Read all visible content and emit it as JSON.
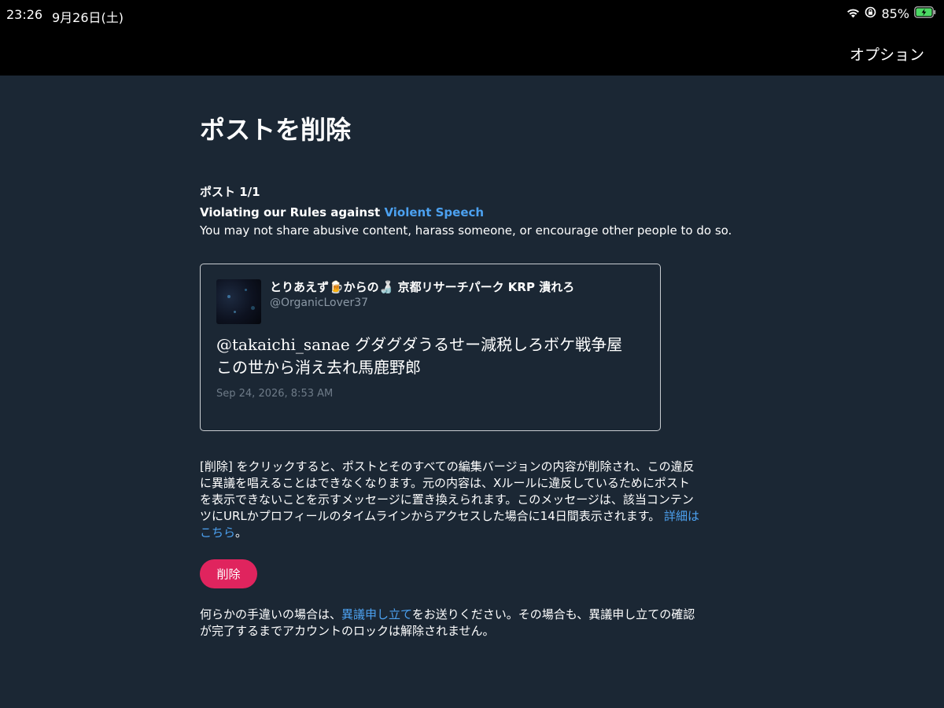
{
  "status_bar": {
    "time": "23:26",
    "date": "9月26日(土)",
    "battery": "85%"
  },
  "nav": {
    "options_label": "オプション"
  },
  "page": {
    "title": "ポストを削除",
    "post_count": "ポスト 1/1",
    "violation_prefix": "Violating our Rules against ",
    "violation_link": "Violent Speech",
    "violation_desc": "You may not share abusive content, harass someone, or encourage other people to do so."
  },
  "post": {
    "display_name": "とりあえず🍺からの🍶 京都リサーチパーク KRP 潰れろ",
    "handle": "@OrganicLover37",
    "text_lines": [
      "@takaichi_sanae グダグダうるせー減税しろボケ戦争屋",
      "この世から消え去れ馬鹿野郎"
    ],
    "timestamp": "Sep 24, 2026, 8:53 AM"
  },
  "explanation": {
    "lines": [
      "[削除] をクリックすると、ポストとそのすべての編集バージョンの内容が削除され、この違反",
      "に異議を唱えることはできなくなります。元の内容は、Xルールに違反しているためにポスト",
      "を表示できないことを示すメッセージに置き換えられます。このメッセージは、該当コンテン",
      "ツにURLかプロフィールのタイムラインからアクセスした場合に14日間表示されます。"
    ],
    "learn_more_part1": "詳細は",
    "learn_more_part2": "こちら",
    "period": "。"
  },
  "delete_button_label": "削除",
  "appeal": {
    "prefix": "何らかの手違いの場合は、",
    "link": "異議申し立て",
    "suffix": "をお送りください。その場合も、異議申し立ての確認",
    "line2": "が完了するまでアカウントのロックは解除されません。"
  },
  "colors": {
    "background": "#15202b",
    "link": "#4ca1f0",
    "delete_button": "#e0245e",
    "muted_text": "#8b98a5"
  }
}
